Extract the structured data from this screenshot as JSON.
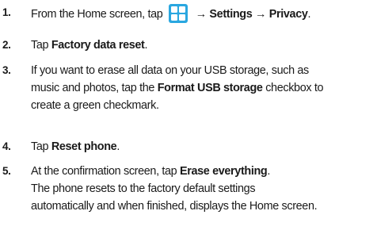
{
  "steps": [
    {
      "number": "1.",
      "before": "From the Home screen, tap",
      "after_icon": "→",
      "settings": "Settings",
      "arrow2": "→",
      "privacy": "Privacy",
      "end": ".",
      "icon": "home-grid-icon",
      "icon_color": "#2aa7e0"
    },
    {
      "number": "2.",
      "before": "Tap ",
      "bold": "Factory data reset",
      "after": "."
    },
    {
      "number": "3.",
      "line1": "If you want to erase all data on your USB storage, such as",
      "line2_before": "music and photos, tap the ",
      "bold": "Format USB storage",
      "line2_after": " checkbox to",
      "line3": "create a green checkmark."
    },
    {
      "number": "4.",
      "before": "Tap ",
      "bold": "Reset phone",
      "after": "."
    },
    {
      "number": "5.",
      "before": "At the confirmation screen, tap ",
      "bold": "Erase everything",
      "after": ".",
      "line2": "The phone resets to the factory default settings",
      "line3": "automatically and when finished, displays the Home screen."
    }
  ]
}
